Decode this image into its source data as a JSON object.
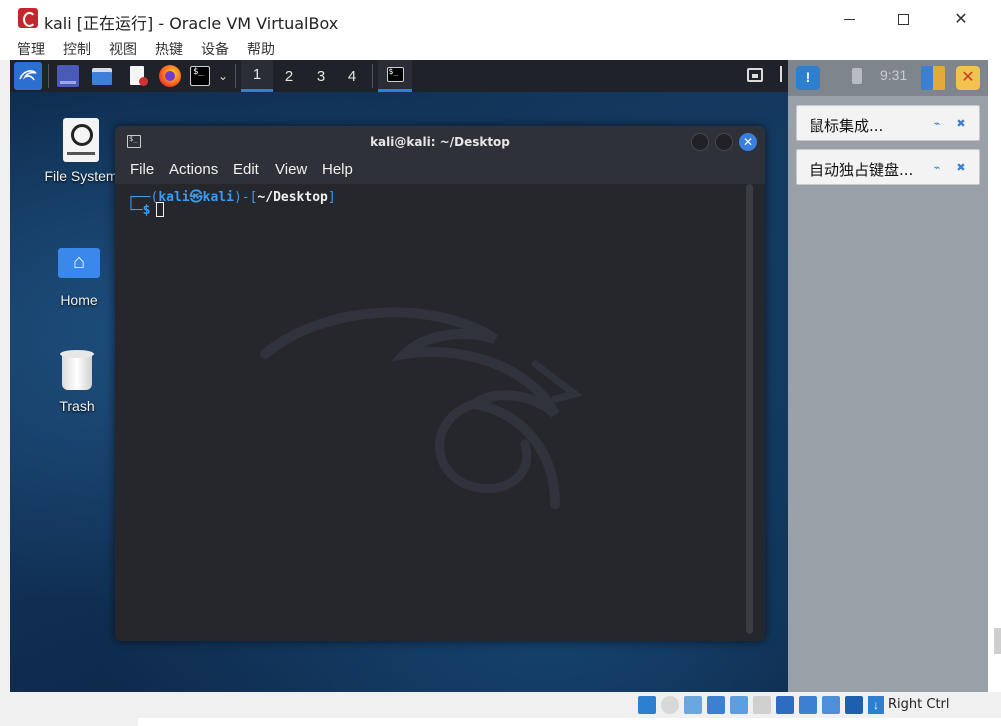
{
  "window": {
    "title": "kali [正在运行] - Oracle VM VirtualBox",
    "controls": {
      "minimize": "minimize",
      "maximize": "maximize",
      "close": "✕"
    }
  },
  "menubar": {
    "items": [
      "管理",
      "控制",
      "视图",
      "热键",
      "设备",
      "帮助"
    ]
  },
  "kali_panel": {
    "workspaces": [
      "1",
      "2",
      "3",
      "4"
    ],
    "active_workspace": "1",
    "launchers": [
      "kali-menu-icon",
      "show-desktop-icon",
      "file-manager-icon",
      "text-editor-icon",
      "firefox-icon",
      "terminal-icon"
    ],
    "terminal_glyph": "$_",
    "chevron": "⌄"
  },
  "desktop": {
    "icons": [
      {
        "label": "File System"
      },
      {
        "label": "Home"
      },
      {
        "label": "Trash"
      }
    ]
  },
  "terminal": {
    "title": "kali@kali: ~/Desktop",
    "close_glyph": "✕",
    "menu": [
      "File",
      "Actions",
      "Edit",
      "View",
      "Help"
    ],
    "prompt": {
      "corner_top": "┌──(",
      "user": "kali㉿kali",
      "mid": ")-[",
      "dir": "~/Desktop",
      "end": "]",
      "corner_bottom": "└─",
      "symbol": "$"
    }
  },
  "vbox_side": {
    "time": "9:31",
    "msg_glyph": "!",
    "x_glyph": "✕",
    "notifications": [
      {
        "text": "鼠标集成..."
      },
      {
        "text": "自动独占键盘..."
      }
    ],
    "note_icon_a": "⌁",
    "note_icon_b": "✖"
  },
  "statusbar": {
    "host_key": "Right Ctrl",
    "arrow_glyph": "↓"
  },
  "colors": {
    "accent": "#2f7fe0",
    "prompt_blue": "#3b9bf0",
    "terminal_bg": "#25272d",
    "panel_bg": "#202229"
  }
}
